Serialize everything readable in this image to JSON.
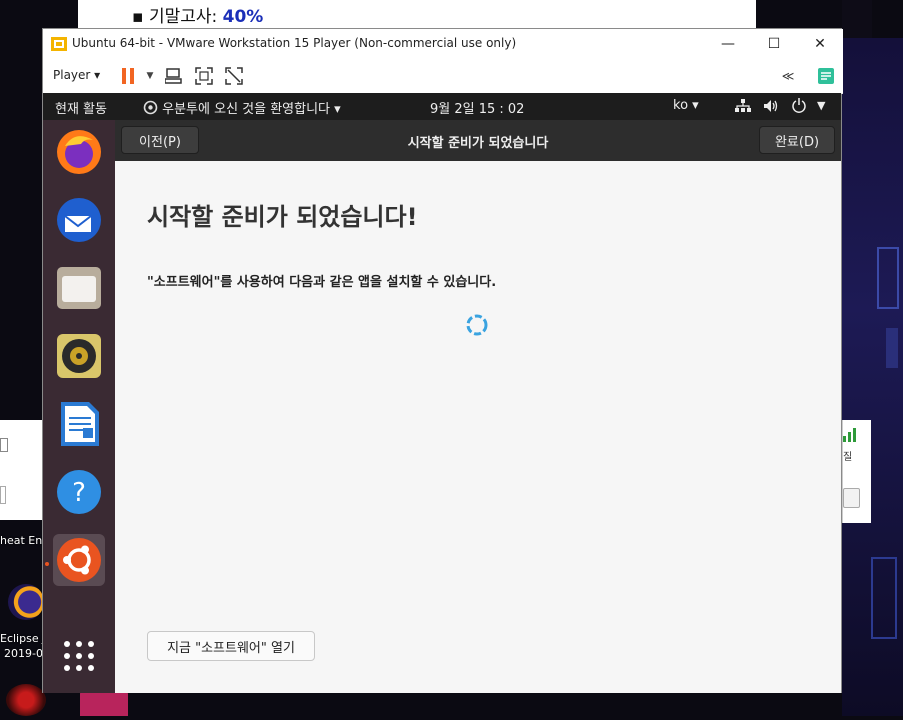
{
  "background": {
    "doc_bullet_label": "기말고사: ",
    "doc_bullet_value": "40%",
    "desktop_icons": [
      {
        "label": "heat Eng"
      },
      {
        "label": "Eclipse J"
      },
      {
        "label": "2019-0"
      }
    ],
    "right_panel_label": "질"
  },
  "vmware": {
    "title": "Ubuntu 64-bit - VMware Workstation 15 Player (Non-commercial use only)",
    "window_buttons": {
      "minimize": "—",
      "maximize": "☐",
      "close": "✕"
    },
    "toolbar": {
      "player_menu": "Player",
      "icons": [
        "pause-icon",
        "send-ctrl-alt-del-icon",
        "fullscreen-icon",
        "unity-icon",
        "collapse-icon",
        "notes-icon"
      ]
    }
  },
  "ubuntu": {
    "topbar": {
      "activities": "현재 활동",
      "app_menu": "우분투에 오신 것을 환영합니다",
      "clock": "9월 2일  15 : 02",
      "input_lang": "ko"
    },
    "dock_apps": [
      "firefox",
      "thunderbird",
      "files",
      "rhythmbox",
      "libreoffice-writer",
      "help",
      "ubuntu-software",
      "show-applications"
    ],
    "header": {
      "back_button": "이전(P)",
      "title": "시작할 준비가 되었습니다",
      "done_button": "완료(D)"
    },
    "content": {
      "heading": "시작할 준비가 되었습니다!",
      "description": "\"소프트웨어\"를 사용하여 다음과 같은 앱을 설치할 수 있습니다.",
      "open_software_button": "지금 \"소프트웨어\" 열기"
    }
  },
  "colors": {
    "ubuntu_orange": "#e95420",
    "dock_bg": "#3a2a33",
    "spinner": "#3aa3e0"
  }
}
